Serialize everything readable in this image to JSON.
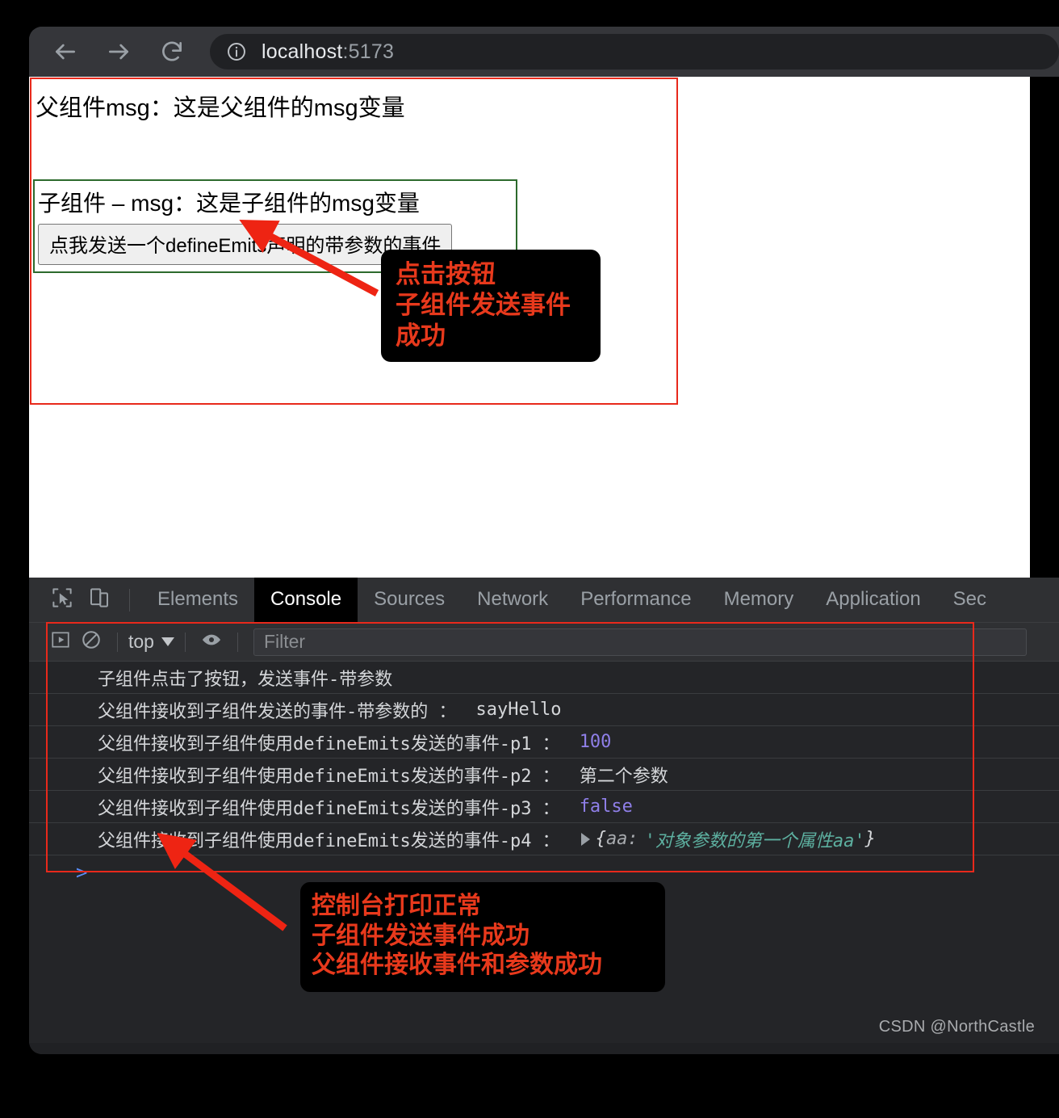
{
  "browser": {
    "nav": {
      "back_label": "Back",
      "forward_label": "Forward",
      "reload_label": "Reload"
    },
    "omnibox": {
      "info_icon": "info-circle-icon",
      "url_host": "localhost",
      "url_port": ":5173"
    }
  },
  "page": {
    "parent_msg": "父组件msg：这是父组件的msg变量",
    "child_msg": "子组件 – msg：这是子组件的msg变量",
    "child_button": "点我发送一个defineEmits声明的带参数的事件"
  },
  "annotations": {
    "top_note": "点击按钮\n子组件发送事件\n成功",
    "bottom_note": "控制台打印正常\n子组件发送事件成功\n父组件接收事件和参数成功",
    "highlight_color": "#e8291b",
    "note_text_color": "#e8391c"
  },
  "devtools": {
    "icons": {
      "inspect": "inspect-element-icon",
      "device": "device-toolbar-icon",
      "sidebar": "console-sidebar-icon",
      "clear": "clear-console-icon",
      "eye": "live-expression-eye-icon"
    },
    "tabs": [
      {
        "label": "Elements",
        "active": false
      },
      {
        "label": "Console",
        "active": true
      },
      {
        "label": "Sources",
        "active": false
      },
      {
        "label": "Network",
        "active": false
      },
      {
        "label": "Performance",
        "active": false
      },
      {
        "label": "Memory",
        "active": false
      },
      {
        "label": "Application",
        "active": false
      },
      {
        "label": "Sec",
        "active": false
      }
    ],
    "console_toolbar": {
      "context": "top",
      "filter_placeholder": "Filter"
    },
    "messages": [
      {
        "text": "子组件点击了按钮，发送事件-带参数",
        "value": "",
        "value_type": "none"
      },
      {
        "text": "父组件接收到子组件发送的事件-带参数的 ：",
        "value": "sayHello",
        "value_type": "string-plain"
      },
      {
        "text": "父组件接收到子组件使用defineEmits发送的事件-p1 ：",
        "value": "100",
        "value_type": "number"
      },
      {
        "text": "父组件接收到子组件使用defineEmits发送的事件-p2 ：",
        "value": "第二个参数",
        "value_type": "string-plain"
      },
      {
        "text": "父组件接收到子组件使用defineEmits发送的事件-p3 ：",
        "value": "false",
        "value_type": "boolean"
      },
      {
        "text": "父组件接收到子组件使用defineEmits发送的事件-p4 ：",
        "value": "",
        "value_type": "object",
        "object": {
          "open": "{",
          "key": "aa:",
          "string": "'对象参数的第一个属性aa'",
          "close": "}"
        }
      }
    ],
    "prompt": ">"
  },
  "watermark": "CSDN @NorthCastle"
}
